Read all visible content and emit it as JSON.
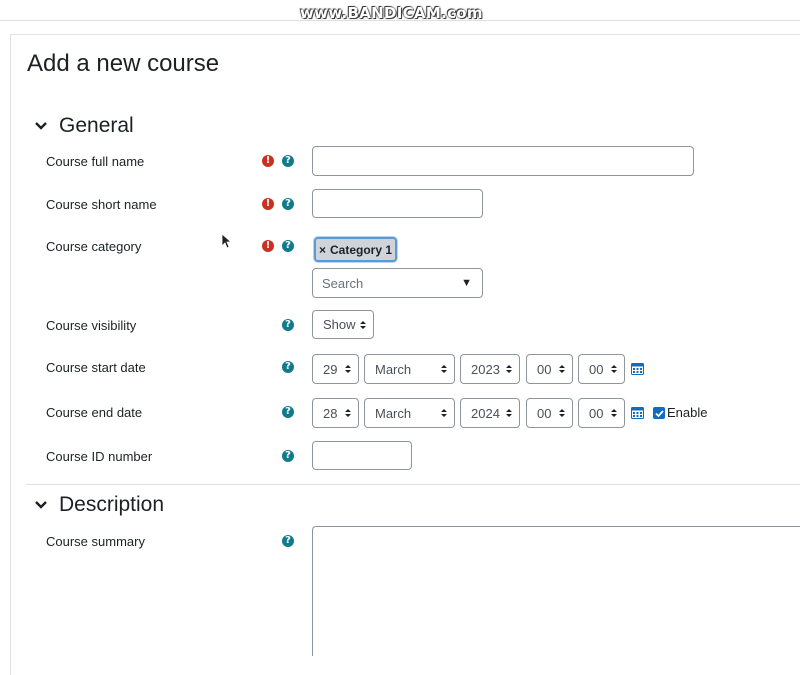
{
  "watermark": "www.BANDICAM.com",
  "page_title": "Add a new course",
  "sections": {
    "general": "General",
    "description": "Description"
  },
  "fields": {
    "full_name": {
      "label": "Course full name",
      "value": ""
    },
    "short_name": {
      "label": "Course short name",
      "value": ""
    },
    "category": {
      "label": "Course category",
      "tag_remove": "×",
      "tag_value": "Category 1",
      "search_placeholder": "Search",
      "caret": "▼"
    },
    "visibility": {
      "label": "Course visibility",
      "value": "Show"
    },
    "start_date": {
      "label": "Course start date",
      "day": "29",
      "month": "March",
      "year": "2023",
      "hour": "00",
      "minute": "00"
    },
    "end_date": {
      "label": "Course end date",
      "day": "28",
      "month": "March",
      "year": "2024",
      "hour": "00",
      "minute": "00",
      "enable_label": "Enable",
      "enabled": true
    },
    "id_number": {
      "label": "Course ID number",
      "value": ""
    },
    "summary": {
      "label": "Course summary",
      "value": ""
    }
  },
  "icons": {
    "required": "exclamation-circle-icon",
    "help": "question-circle-icon",
    "calendar": "calendar-icon",
    "collapse": "chevron-down-icon"
  },
  "colors": {
    "required": "#ca3120",
    "help": "#117a8b",
    "accent": "#0f6cbf"
  }
}
